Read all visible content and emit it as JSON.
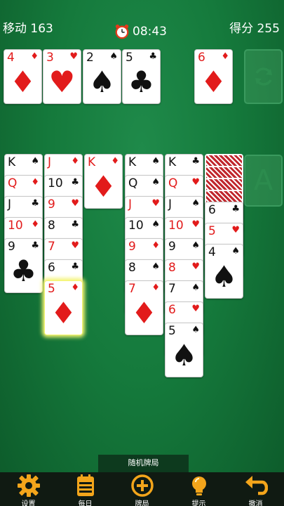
{
  "header": {
    "moves": "移动 163",
    "time": "08:43",
    "score": "得分 255"
  },
  "foundations": [
    {
      "rank": "4",
      "suit": "♦",
      "color": "red"
    },
    {
      "rank": "3",
      "suit": "♥",
      "color": "red"
    },
    {
      "rank": "2",
      "suit": "♠",
      "color": "black"
    },
    {
      "rank": "5",
      "suit": "♣",
      "color": "black"
    }
  ],
  "waste": {
    "rank": "6",
    "suit": "♦",
    "color": "red"
  },
  "stock_slot_label": "A",
  "tableau": [
    [
      {
        "rank": "K",
        "suit": "♠",
        "color": "black"
      },
      {
        "rank": "Q",
        "suit": "♦",
        "color": "red"
      },
      {
        "rank": "J",
        "suit": "♣",
        "color": "black"
      },
      {
        "rank": "10",
        "suit": "♦",
        "color": "red"
      },
      {
        "rank": "9",
        "suit": "♣",
        "color": "black"
      }
    ],
    [
      {
        "rank": "J",
        "suit": "♦",
        "color": "red"
      },
      {
        "rank": "10",
        "suit": "♣",
        "color": "black"
      },
      {
        "rank": "9",
        "suit": "♥",
        "color": "red"
      },
      {
        "rank": "8",
        "suit": "♣",
        "color": "black"
      },
      {
        "rank": "7",
        "suit": "♥",
        "color": "red"
      },
      {
        "rank": "6",
        "suit": "♣",
        "color": "black"
      },
      {
        "rank": "5",
        "suit": "♦",
        "color": "red"
      }
    ],
    [
      {
        "rank": "K",
        "suit": "♦",
        "color": "red"
      }
    ],
    [
      {
        "rank": "K",
        "suit": "♠",
        "color": "black"
      },
      {
        "rank": "Q",
        "suit": "♠",
        "color": "black"
      },
      {
        "rank": "J",
        "suit": "♥",
        "color": "red"
      },
      {
        "rank": "10",
        "suit": "♠",
        "color": "black"
      },
      {
        "rank": "9",
        "suit": "♦",
        "color": "red"
      },
      {
        "rank": "8",
        "suit": "♠",
        "color": "black"
      },
      {
        "rank": "7",
        "suit": "♦",
        "color": "red"
      }
    ],
    [
      {
        "rank": "K",
        "suit": "♣",
        "color": "black"
      },
      {
        "rank": "Q",
        "suit": "♥",
        "color": "red"
      },
      {
        "rank": "J",
        "suit": "♠",
        "color": "black"
      },
      {
        "rank": "10",
        "suit": "♥",
        "color": "red"
      },
      {
        "rank": "9",
        "suit": "♠",
        "color": "black"
      },
      {
        "rank": "8",
        "suit": "♥",
        "color": "red"
      },
      {
        "rank": "7",
        "suit": "♠",
        "color": "black"
      },
      {
        "rank": "6",
        "suit": "♥",
        "color": "red"
      },
      {
        "rank": "5",
        "suit": "♠",
        "color": "black"
      }
    ],
    [
      {
        "rank": "6",
        "suit": "♣",
        "color": "black"
      },
      {
        "rank": "5",
        "suit": "♥",
        "color": "red"
      },
      {
        "rank": "4",
        "suit": "♠",
        "color": "black"
      }
    ]
  ],
  "tableau_facedown_count_col6": 4,
  "random_deal_label": "随机牌局",
  "nav": [
    {
      "label": "设置",
      "icon": "gear-icon"
    },
    {
      "label": "每日",
      "icon": "calendar-icon"
    },
    {
      "label": "牌局",
      "icon": "plus-circle-icon"
    },
    {
      "label": "提示",
      "icon": "lightbulb-icon"
    },
    {
      "label": "撤消",
      "icon": "undo-icon"
    }
  ],
  "colors": {
    "table": "#157a3c",
    "red_suit": "#e21b1b",
    "icon_gold": "#f3a51b"
  }
}
